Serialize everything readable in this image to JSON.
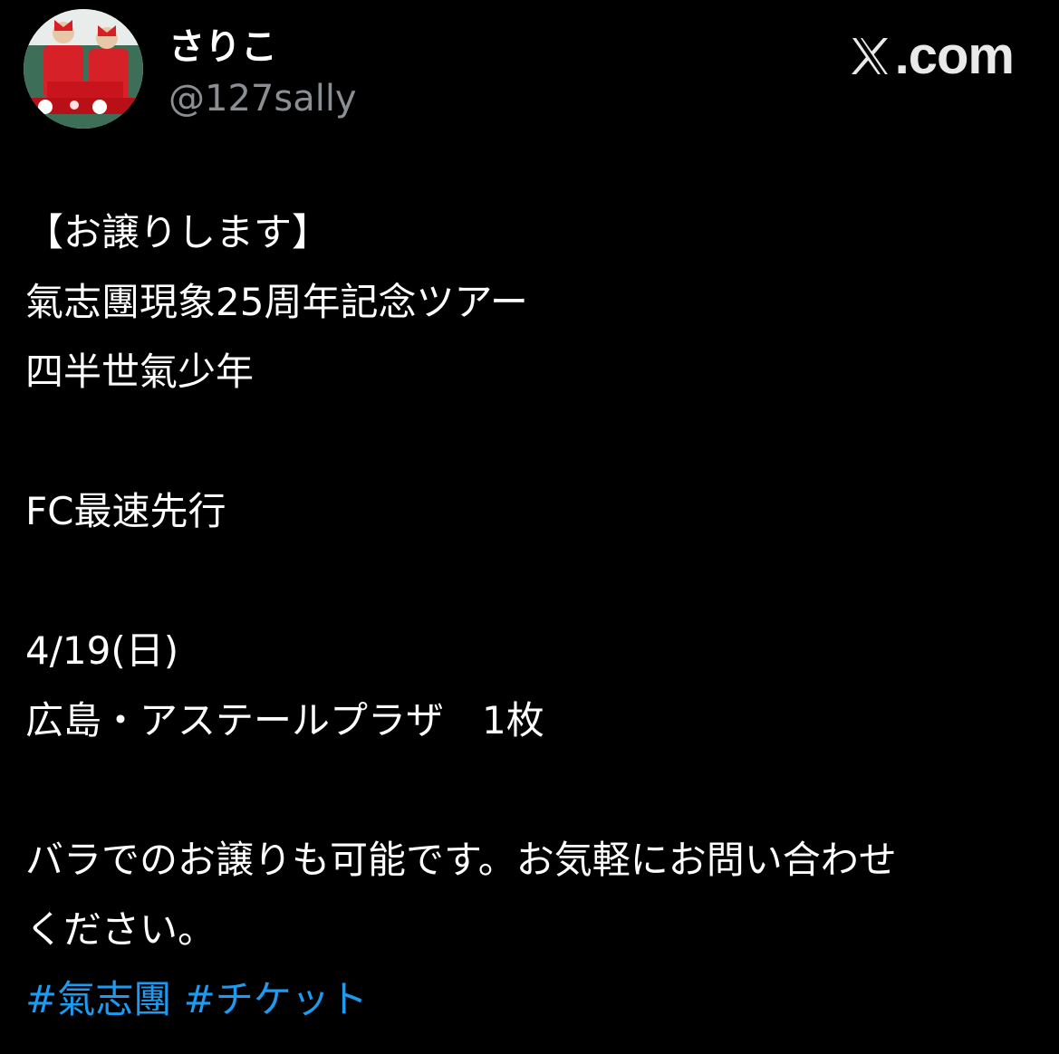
{
  "post": {
    "author": {
      "display_name": "さりこ",
      "handle": "@127sally",
      "avatar": "avatar-photo"
    },
    "brand": {
      "icon": "x-logo-icon",
      "text": ".com"
    },
    "lines": {
      "l1": "【お譲りします】",
      "l2": "氣志團現象25周年記念ツアー",
      "l3": "四半世氣少年",
      "l4": "FC最速先行",
      "l5": "4/19(日)",
      "l6": "広島・アステールプラザ　1枚",
      "l7": "バラでのお譲りも可能です。お気軽にお問い合わせ",
      "l8": "ください。"
    },
    "hashtags": [
      "#氣志團",
      "#チケット"
    ]
  },
  "colors": {
    "background": "#000000",
    "text": "#ffffff",
    "secondary_text": "#8b8f94",
    "hashtag": "#1d9bf0"
  }
}
